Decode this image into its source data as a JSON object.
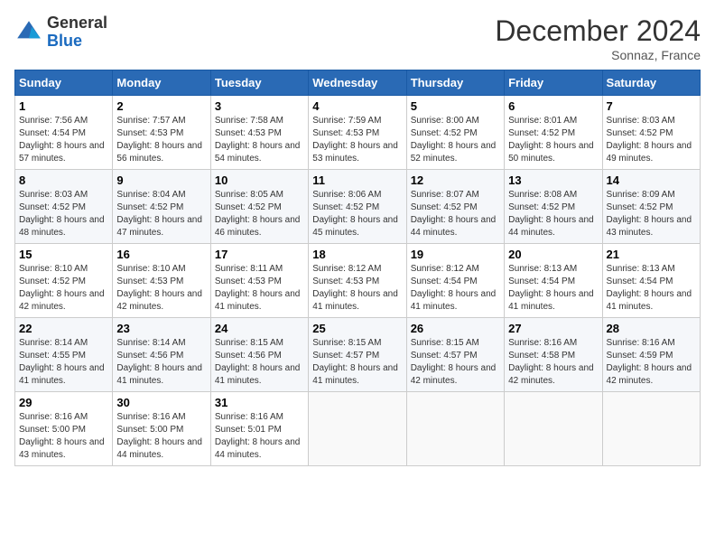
{
  "header": {
    "logo_general": "General",
    "logo_blue": "Blue",
    "month_title": "December 2024",
    "location": "Sonnaz, France"
  },
  "days_of_week": [
    "Sunday",
    "Monday",
    "Tuesday",
    "Wednesday",
    "Thursday",
    "Friday",
    "Saturday"
  ],
  "weeks": [
    [
      {
        "day": "1",
        "sunrise": "Sunrise: 7:56 AM",
        "sunset": "Sunset: 4:54 PM",
        "daylight": "Daylight: 8 hours and 57 minutes."
      },
      {
        "day": "2",
        "sunrise": "Sunrise: 7:57 AM",
        "sunset": "Sunset: 4:53 PM",
        "daylight": "Daylight: 8 hours and 56 minutes."
      },
      {
        "day": "3",
        "sunrise": "Sunrise: 7:58 AM",
        "sunset": "Sunset: 4:53 PM",
        "daylight": "Daylight: 8 hours and 54 minutes."
      },
      {
        "day": "4",
        "sunrise": "Sunrise: 7:59 AM",
        "sunset": "Sunset: 4:53 PM",
        "daylight": "Daylight: 8 hours and 53 minutes."
      },
      {
        "day": "5",
        "sunrise": "Sunrise: 8:00 AM",
        "sunset": "Sunset: 4:52 PM",
        "daylight": "Daylight: 8 hours and 52 minutes."
      },
      {
        "day": "6",
        "sunrise": "Sunrise: 8:01 AM",
        "sunset": "Sunset: 4:52 PM",
        "daylight": "Daylight: 8 hours and 50 minutes."
      },
      {
        "day": "7",
        "sunrise": "Sunrise: 8:03 AM",
        "sunset": "Sunset: 4:52 PM",
        "daylight": "Daylight: 8 hours and 49 minutes."
      }
    ],
    [
      {
        "day": "8",
        "sunrise": "Sunrise: 8:03 AM",
        "sunset": "Sunset: 4:52 PM",
        "daylight": "Daylight: 8 hours and 48 minutes."
      },
      {
        "day": "9",
        "sunrise": "Sunrise: 8:04 AM",
        "sunset": "Sunset: 4:52 PM",
        "daylight": "Daylight: 8 hours and 47 minutes."
      },
      {
        "day": "10",
        "sunrise": "Sunrise: 8:05 AM",
        "sunset": "Sunset: 4:52 PM",
        "daylight": "Daylight: 8 hours and 46 minutes."
      },
      {
        "day": "11",
        "sunrise": "Sunrise: 8:06 AM",
        "sunset": "Sunset: 4:52 PM",
        "daylight": "Daylight: 8 hours and 45 minutes."
      },
      {
        "day": "12",
        "sunrise": "Sunrise: 8:07 AM",
        "sunset": "Sunset: 4:52 PM",
        "daylight": "Daylight: 8 hours and 44 minutes."
      },
      {
        "day": "13",
        "sunrise": "Sunrise: 8:08 AM",
        "sunset": "Sunset: 4:52 PM",
        "daylight": "Daylight: 8 hours and 44 minutes."
      },
      {
        "day": "14",
        "sunrise": "Sunrise: 8:09 AM",
        "sunset": "Sunset: 4:52 PM",
        "daylight": "Daylight: 8 hours and 43 minutes."
      }
    ],
    [
      {
        "day": "15",
        "sunrise": "Sunrise: 8:10 AM",
        "sunset": "Sunset: 4:52 PM",
        "daylight": "Daylight: 8 hours and 42 minutes."
      },
      {
        "day": "16",
        "sunrise": "Sunrise: 8:10 AM",
        "sunset": "Sunset: 4:53 PM",
        "daylight": "Daylight: 8 hours and 42 minutes."
      },
      {
        "day": "17",
        "sunrise": "Sunrise: 8:11 AM",
        "sunset": "Sunset: 4:53 PM",
        "daylight": "Daylight: 8 hours and 41 minutes."
      },
      {
        "day": "18",
        "sunrise": "Sunrise: 8:12 AM",
        "sunset": "Sunset: 4:53 PM",
        "daylight": "Daylight: 8 hours and 41 minutes."
      },
      {
        "day": "19",
        "sunrise": "Sunrise: 8:12 AM",
        "sunset": "Sunset: 4:54 PM",
        "daylight": "Daylight: 8 hours and 41 minutes."
      },
      {
        "day": "20",
        "sunrise": "Sunrise: 8:13 AM",
        "sunset": "Sunset: 4:54 PM",
        "daylight": "Daylight: 8 hours and 41 minutes."
      },
      {
        "day": "21",
        "sunrise": "Sunrise: 8:13 AM",
        "sunset": "Sunset: 4:54 PM",
        "daylight": "Daylight: 8 hours and 41 minutes."
      }
    ],
    [
      {
        "day": "22",
        "sunrise": "Sunrise: 8:14 AM",
        "sunset": "Sunset: 4:55 PM",
        "daylight": "Daylight: 8 hours and 41 minutes."
      },
      {
        "day": "23",
        "sunrise": "Sunrise: 8:14 AM",
        "sunset": "Sunset: 4:56 PM",
        "daylight": "Daylight: 8 hours and 41 minutes."
      },
      {
        "day": "24",
        "sunrise": "Sunrise: 8:15 AM",
        "sunset": "Sunset: 4:56 PM",
        "daylight": "Daylight: 8 hours and 41 minutes."
      },
      {
        "day": "25",
        "sunrise": "Sunrise: 8:15 AM",
        "sunset": "Sunset: 4:57 PM",
        "daylight": "Daylight: 8 hours and 41 minutes."
      },
      {
        "day": "26",
        "sunrise": "Sunrise: 8:15 AM",
        "sunset": "Sunset: 4:57 PM",
        "daylight": "Daylight: 8 hours and 42 minutes."
      },
      {
        "day": "27",
        "sunrise": "Sunrise: 8:16 AM",
        "sunset": "Sunset: 4:58 PM",
        "daylight": "Daylight: 8 hours and 42 minutes."
      },
      {
        "day": "28",
        "sunrise": "Sunrise: 8:16 AM",
        "sunset": "Sunset: 4:59 PM",
        "daylight": "Daylight: 8 hours and 42 minutes."
      }
    ],
    [
      {
        "day": "29",
        "sunrise": "Sunrise: 8:16 AM",
        "sunset": "Sunset: 5:00 PM",
        "daylight": "Daylight: 8 hours and 43 minutes."
      },
      {
        "day": "30",
        "sunrise": "Sunrise: 8:16 AM",
        "sunset": "Sunset: 5:00 PM",
        "daylight": "Daylight: 8 hours and 44 minutes."
      },
      {
        "day": "31",
        "sunrise": "Sunrise: 8:16 AM",
        "sunset": "Sunset: 5:01 PM",
        "daylight": "Daylight: 8 hours and 44 minutes."
      },
      null,
      null,
      null,
      null
    ]
  ]
}
